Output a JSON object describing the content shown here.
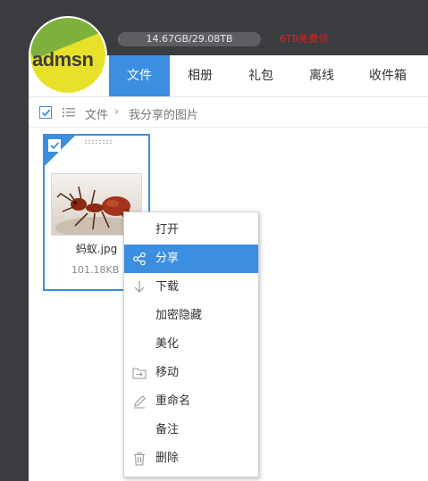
{
  "topbar": {
    "storage_text": "14.67GB/29.08TB",
    "storage_fraction": 0.0005,
    "promo_text": "6TB免费领",
    "promo_color": "#e02020"
  },
  "avatar": {
    "logo_text": "admsn"
  },
  "nav": {
    "tabs": [
      {
        "label": "文件",
        "active": true
      },
      {
        "label": "相册",
        "active": false
      },
      {
        "label": "礼包",
        "active": false
      },
      {
        "label": "离线",
        "active": false
      },
      {
        "label": "收件箱",
        "active": false
      }
    ]
  },
  "breadcrumb": {
    "root": "文件",
    "separator": "›",
    "current": "我分享的图片"
  },
  "file": {
    "name": "蚂蚁.jpg",
    "size": "101.18KB",
    "selected": true
  },
  "context_menu": {
    "items": [
      {
        "label": "打开",
        "icon": "none",
        "highlighted": false
      },
      {
        "label": "分享",
        "icon": "share-icon",
        "highlighted": true
      },
      {
        "label": "下载",
        "icon": "download-icon",
        "highlighted": false
      },
      {
        "label": "加密隐藏",
        "icon": "none",
        "highlighted": false
      },
      {
        "label": "美化",
        "icon": "none",
        "highlighted": false
      },
      {
        "label": "移动",
        "icon": "folder-move-icon",
        "highlighted": false
      },
      {
        "label": "重命名",
        "icon": "pencil-icon",
        "highlighted": false
      },
      {
        "label": "备注",
        "icon": "none",
        "highlighted": false
      },
      {
        "label": "删除",
        "icon": "trash-icon",
        "highlighted": false
      }
    ]
  },
  "colors": {
    "accent": "#3c8ee0",
    "topbar_bg": "#3a3c40"
  }
}
